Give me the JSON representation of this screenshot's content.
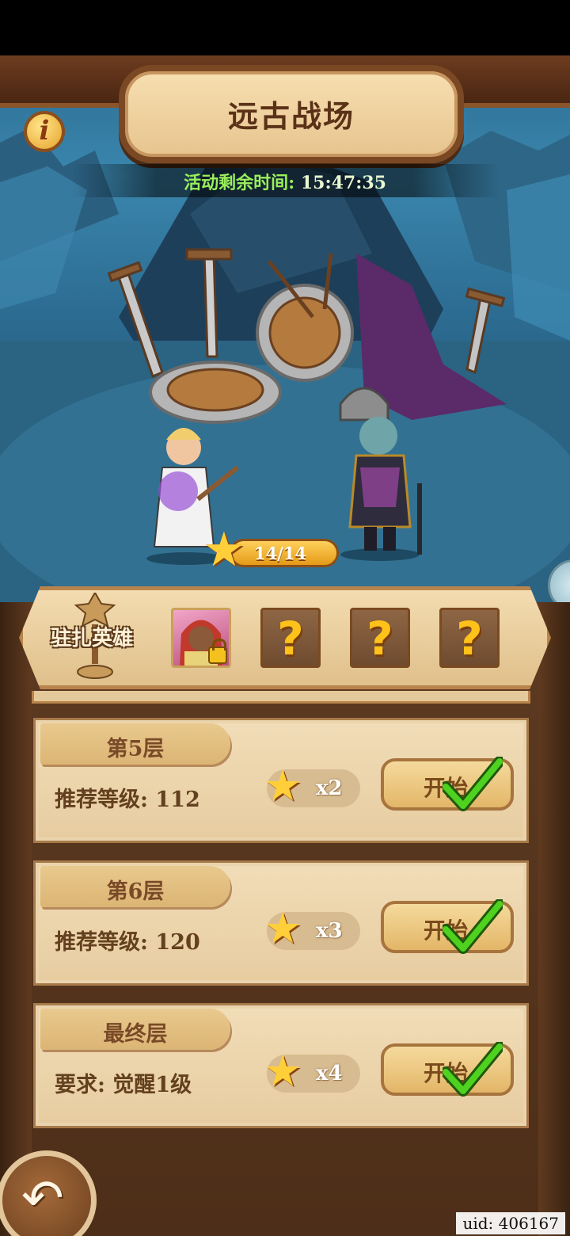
{
  "header": {
    "title": "远古战场",
    "info_icon": "info-icon"
  },
  "timer": {
    "label": "活动剩余时间: ",
    "value": "15:47:35"
  },
  "progress": {
    "stars": "14/14"
  },
  "hero_strip": {
    "label": "驻扎英雄",
    "slots": [
      {
        "type": "hero",
        "locked": true
      },
      {
        "type": "unknown",
        "symbol": "?"
      },
      {
        "type": "unknown",
        "symbol": "?"
      },
      {
        "type": "unknown",
        "symbol": "?"
      }
    ]
  },
  "floors": [
    {
      "name": "第5层",
      "requirement": "推荐等级: 112",
      "stars": "x2",
      "button": "开始",
      "completed": true
    },
    {
      "name": "第6层",
      "requirement": "推荐等级: 120",
      "stars": "x3",
      "button": "开始",
      "completed": true
    },
    {
      "name": "最终层",
      "requirement": "要求: 觉醒1级",
      "stars": "x4",
      "button": "开始",
      "completed": true
    }
  ],
  "footer": {
    "uid": "uid: 406167",
    "back_icon": "back-arrow-icon"
  },
  "colors": {
    "accent_gold": "#ffcf3a",
    "timer_green": "#9aef5b",
    "wood_dark": "#5d3b22"
  }
}
